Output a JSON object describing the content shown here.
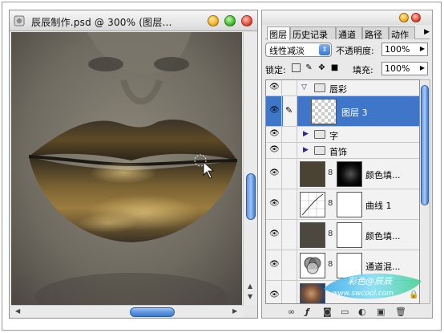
{
  "document": {
    "title": "辰辰制作.psd @ 300% (图层..."
  },
  "layers_panel": {
    "tabs": [
      "图层",
      "历史记录",
      "通道",
      "路径",
      "动作"
    ],
    "blend_mode": "线性减淡",
    "opacity_label": "不透明度:",
    "opacity_value": "100%",
    "lock_label": "锁定:",
    "fill_label": "填充:",
    "fill_value": "100%",
    "layers": [
      {
        "name": "唇彩",
        "kind": "group-open"
      },
      {
        "name": "图层 3",
        "kind": "layer",
        "selected": true
      },
      {
        "name": "字",
        "kind": "group"
      },
      {
        "name": "首饰",
        "kind": "group"
      },
      {
        "name": "颜色填...",
        "kind": "fill"
      },
      {
        "name": "曲线 1",
        "kind": "curves"
      },
      {
        "name": "颜色填...",
        "kind": "fill"
      },
      {
        "name": "通道混...",
        "kind": "mixer"
      },
      {
        "name": "",
        "kind": "background"
      }
    ],
    "bottom_icons": [
      "link-layers-icon",
      "layer-style-icon",
      "mask-icon",
      "new-group-icon",
      "adjustment-layer-icon",
      "new-layer-icon",
      "trash-icon"
    ]
  },
  "watermark": {
    "line1": "彩色@辰辰",
    "line2": "www.swcool.com"
  },
  "colors": {
    "selection": "#3f76c9",
    "scroll_thumb": "#5f94e0"
  }
}
